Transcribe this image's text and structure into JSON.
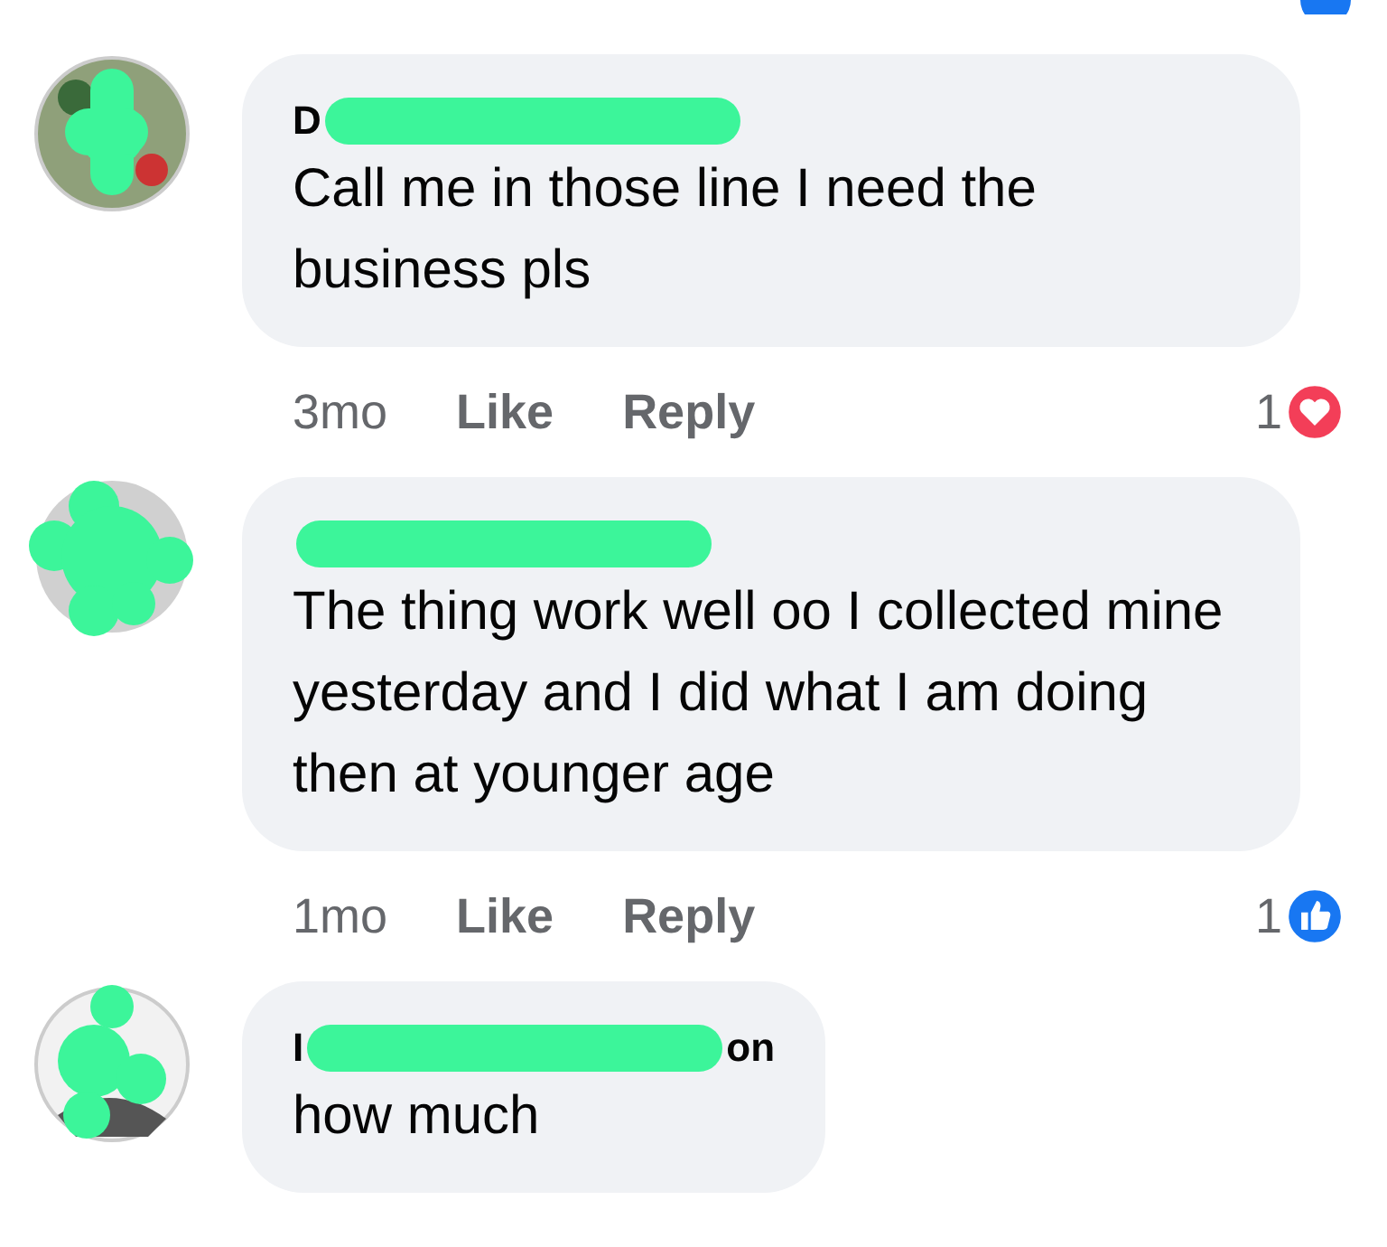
{
  "comments": [
    {
      "author_visible": [
        "D"
      ],
      "text": "Call me in those line I need the business pls",
      "time": "3mo",
      "actions": [
        "Like",
        "Reply"
      ],
      "reaction": {
        "kind": "love",
        "count": "1"
      }
    },
    {
      "text": "The thing work well oo I collected mine yesterday and I did what I am doing then at younger age",
      "time": "1mo",
      "actions": [
        "Like",
        "Reply"
      ],
      "reaction": {
        "kind": "like",
        "count": "1"
      }
    },
    {
      "author_visible": [
        "I",
        "on"
      ],
      "text": "how much"
    }
  ]
}
